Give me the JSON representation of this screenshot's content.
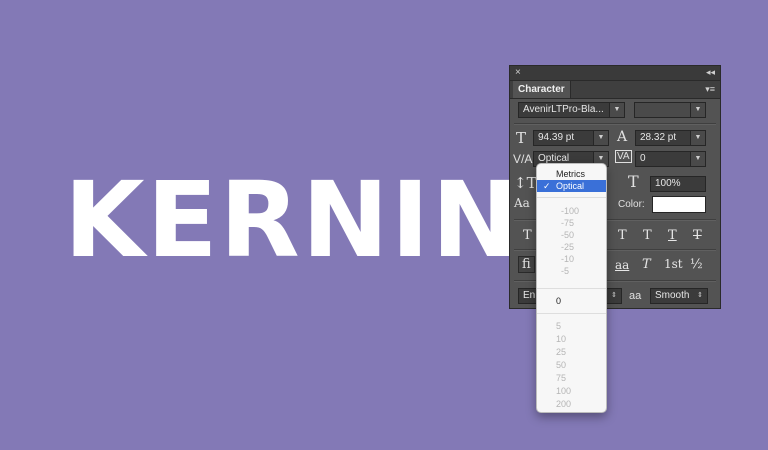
{
  "canvas": {
    "headline": "KERNING"
  },
  "panel": {
    "close_icon": "×",
    "collapse_icon": "◂◂",
    "menu_icon": "▾≡",
    "tab_label": "Character",
    "font_family": "AvenirLTPro-Bla...",
    "font_style_placeholder": "",
    "font_size": "94.39 pt",
    "leading": "28.32 pt",
    "kerning": "Optical",
    "tracking": "0",
    "horizontal_scale": "100%",
    "color_label": "Color:",
    "color_value": "#ffffff",
    "language": "En",
    "aa_label": "aa",
    "antialias": "Smooth",
    "type_style_buttons": [
      "T",
      "T",
      "T",
      "T",
      "T"
    ],
    "opentype_buttons": [
      "ﬁ",
      "aa",
      "T",
      "1st",
      "½"
    ]
  },
  "kerning_menu": {
    "items_top": [
      {
        "label": "Metrics",
        "selected": false
      },
      {
        "label": "Optical",
        "selected": true
      }
    ],
    "negative": [
      "-100",
      "-75",
      "-50",
      "-25",
      "-10",
      "-5"
    ],
    "zero": "0",
    "positive": [
      "5",
      "10",
      "25",
      "50",
      "75",
      "100",
      "200"
    ],
    "checkmark": "✓"
  },
  "colors": {
    "background": "#8379b6",
    "panel": "#535353",
    "menu_highlight": "#3a70d8"
  }
}
